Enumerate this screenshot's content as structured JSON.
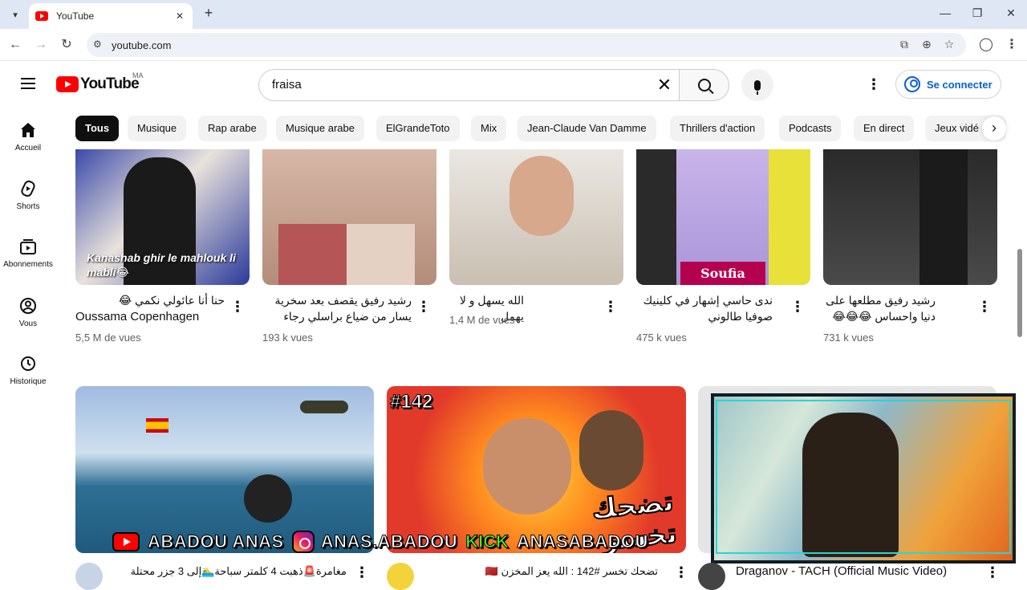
{
  "browser": {
    "tab_title": "YouTube",
    "new_tab": "+",
    "url": "youtube.com"
  },
  "header": {
    "logo_text": "YouTube",
    "region": "MA",
    "search_value": "fraisa",
    "sign_in": "Se connecter"
  },
  "chips": [
    {
      "label": "Tous",
      "active": true
    },
    {
      "label": "Musique"
    },
    {
      "label": "Rap arabe"
    },
    {
      "label": "Musique arabe"
    },
    {
      "label": "ElGrandeToto"
    },
    {
      "label": "Mix"
    },
    {
      "label": "Jean-Claude Van Damme"
    },
    {
      "label": "Thrillers d'action"
    },
    {
      "label": "Podcasts"
    },
    {
      "label": "En direct"
    },
    {
      "label": "Jeux vidé"
    }
  ],
  "sidebar": [
    {
      "label": "Accueil",
      "icon": "home-icon"
    },
    {
      "label": "Shorts",
      "icon": "shorts-icon"
    },
    {
      "label": "Abonnements",
      "icon": "subscriptions-icon"
    },
    {
      "label": "Vous",
      "icon": "you-icon"
    },
    {
      "label": "Historique",
      "icon": "history-icon"
    }
  ],
  "row1": [
    {
      "title": "حنا أنا عائولي نكمي 😂",
      "channel": "Oussama Copenhagen",
      "views": "5,5 M de vues",
      "thumb_text": "Kanashab ghir le mahlouk li mabli😂"
    },
    {
      "title": "رشيد رفيق يقصف بعد سخرية يسار من ضياع براسلي رجاء بلمير 😨...",
      "channel": "",
      "views": "193 k vues"
    },
    {
      "title": "الله يسهل و لا يهمل",
      "channel": "",
      "views": "1,4 M de vues"
    },
    {
      "title": "ندى حاسي إشهار في كلينيك صوفيا طالوني",
      "channel": "",
      "views": "475 k vues",
      "thumb_text": "Soufia"
    },
    {
      "title": "رشيد رفيق مطلعها على دنيا واحساس 😂😂😂",
      "channel": "",
      "views": "731 k vues"
    }
  ],
  "row2": [
    {
      "title": "مغامرة🚨ذهبت 4 كلمتر سباحة🏊‍♂️إلى 3 جزر محتلة"
    },
    {
      "title": "تضحك تخسر #142 : الله يعز المخزن 🇲🇦",
      "thumb_badge": "#142",
      "thumb_text": "تضحك تخسر"
    },
    {
      "title": "Draganov - TACH (Official Music Video)"
    }
  ],
  "banner": {
    "yt_name": "ABADOU ANAS",
    "ig_name": "ANAS.ABADOU",
    "kick_label": "KICK",
    "kick_name": "ANASABADOU"
  },
  "colors": {
    "brand": "#ff0000",
    "link": "#065fd4"
  }
}
